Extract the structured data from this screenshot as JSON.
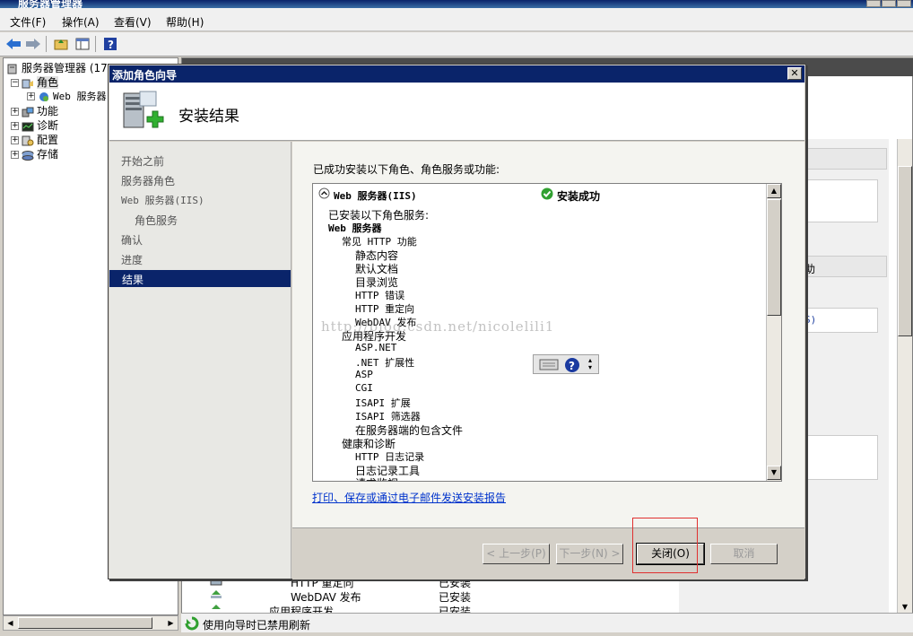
{
  "window": {
    "title": "服务器管理器"
  },
  "menu": [
    "文件(F)",
    "操作(A)",
    "查看(V)",
    "帮助(H)"
  ],
  "tree": {
    "root": "服务器管理器 (17",
    "items": [
      {
        "label": "角色",
        "expanded": true
      },
      {
        "label": "Web 服务器",
        "child": true
      },
      {
        "label": "功能"
      },
      {
        "label": "诊断"
      },
      {
        "label": "配置"
      },
      {
        "label": "存储"
      }
    ]
  },
  "right_pane": {
    "action_text_1": "助",
    "action_text_2": "S)",
    "lower_rows": [
      {
        "name": "HTTP 重定向",
        "status": "已安装"
      },
      {
        "name": "WebDAV 发布",
        "status": "已安装"
      },
      {
        "name": "应用程序开发",
        "status": "已安装"
      }
    ]
  },
  "status_bar": {
    "text": "使用向导时已禁用刷新"
  },
  "dialog": {
    "title": "添加角色向导",
    "header": "安装结果",
    "nav": [
      "开始之前",
      "服务器角色",
      "Web 服务器(IIS)",
      "角色服务",
      "确认",
      "进度",
      "结果"
    ],
    "selected_nav": "结果",
    "intro": "已成功安装以下角色、角色服务或功能:",
    "result": {
      "role": "Web 服务器(IIS)",
      "status": "安装成功",
      "lines": [
        "已安装以下角色服务:",
        "Web 服务器",
        "常见 HTTP 功能",
        "静态内容",
        "默认文档",
        "目录浏览",
        "HTTP 错误",
        "HTTP 重定向",
        "WebDAV 发布",
        "应用程序开发",
        "ASP.NET",
        ".NET 扩展性",
        "ASP",
        "CGI",
        "ISAPI 扩展",
        "ISAPI 筛选器",
        "在服务器端的包含文件",
        "健康和诊断",
        "HTTP 日志记录",
        "日志记录工具",
        "请求监视"
      ]
    },
    "link": "打印、保存或通过电子邮件发送安装报告",
    "buttons": {
      "prev": "< 上一步(P)",
      "next": "下一步(N) >",
      "close": "关闭(O)",
      "cancel": "取消"
    }
  },
  "watermark": "http://blog.csdn.net/nicolelili1"
}
